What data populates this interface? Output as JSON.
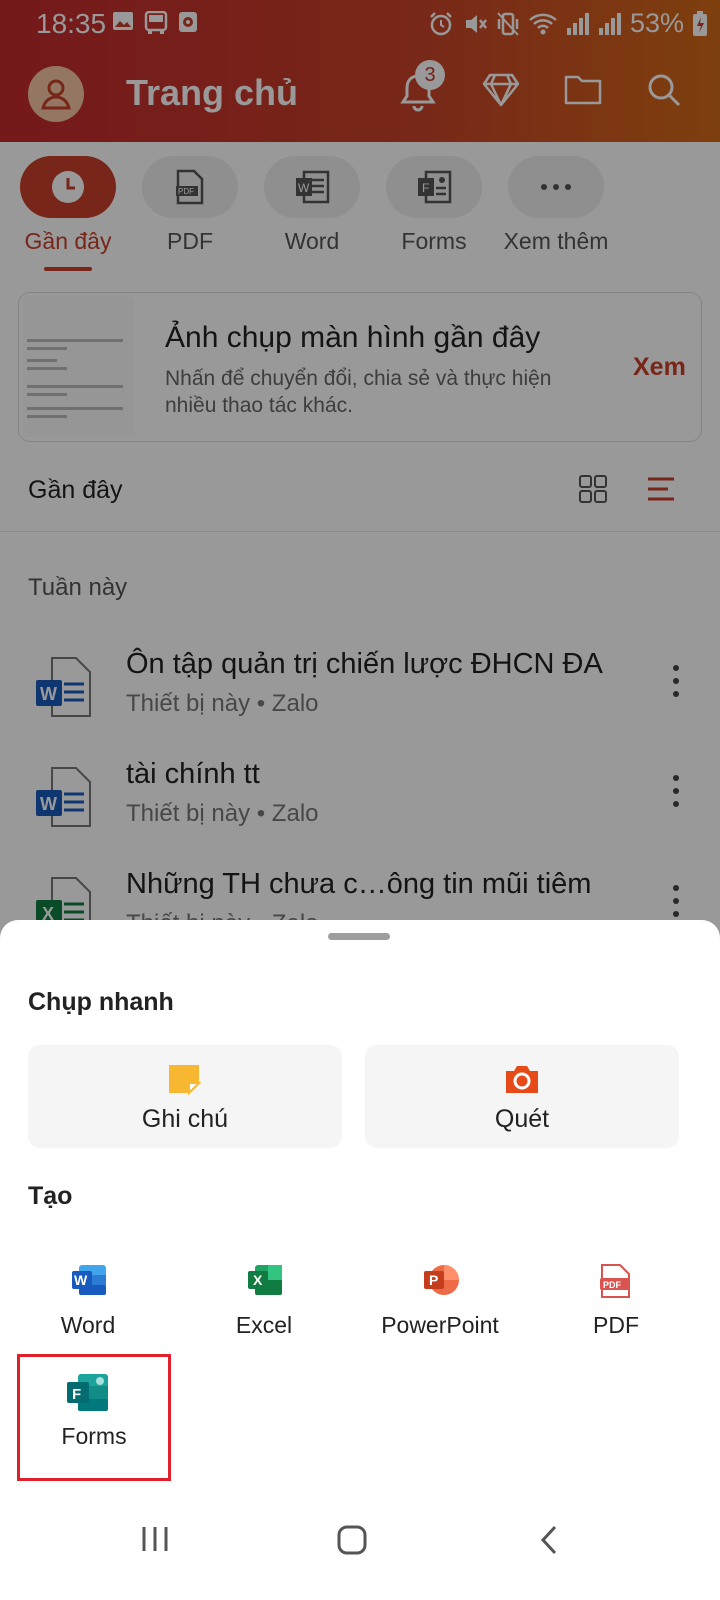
{
  "status_bar": {
    "time": "18:35",
    "battery": "53%"
  },
  "app_bar": {
    "title": "Trang chủ",
    "notification_count": "3"
  },
  "categories": [
    {
      "label": "Gần đây",
      "icon": "clock-icon",
      "active": true
    },
    {
      "label": "PDF",
      "icon": "pdf-icon",
      "active": false
    },
    {
      "label": "Word",
      "icon": "word-icon",
      "active": false
    },
    {
      "label": "Forms",
      "icon": "forms-icon",
      "active": false
    },
    {
      "label": "Xem thêm",
      "icon": "more-horizontal-icon",
      "active": false
    }
  ],
  "banner": {
    "title": "Ảnh chụp màn hình gần đây",
    "subtitle": "Nhấn để chuyển đổi, chia sẻ và thực hiện nhiều thao tác khác.",
    "action": "Xem"
  },
  "recent": {
    "title": "Gần đây",
    "week_label": "Tuần này",
    "files": [
      {
        "name": "Ôn tập quản trị chiến lược ĐHCN ĐA",
        "meta": "Thiết bị này • Zalo",
        "type": "word"
      },
      {
        "name": "tài chính tt",
        "meta": "Thiết bị này • Zalo",
        "type": "word"
      },
      {
        "name": "Những TH chưa c…ông tin mũi tiêm",
        "meta": "Thiết bị này • Zalo",
        "type": "excel"
      }
    ]
  },
  "sheet": {
    "quick_title": "Chụp nhanh",
    "quick_actions": [
      {
        "label": "Ghi chú",
        "icon": "sticky-note-icon"
      },
      {
        "label": "Quét",
        "icon": "camera-icon"
      }
    ],
    "create_title": "Tạo",
    "create_items": [
      {
        "label": "Word",
        "icon": "word-app-icon"
      },
      {
        "label": "Excel",
        "icon": "excel-app-icon"
      },
      {
        "label": "PowerPoint",
        "icon": "powerpoint-app-icon"
      },
      {
        "label": "PDF",
        "icon": "pdf-app-icon"
      },
      {
        "label": "Forms",
        "icon": "forms-app-icon",
        "highlighted": true
      }
    ]
  },
  "colors": {
    "brand": "#c8402a",
    "highlight": "#e0202a",
    "word": "#185abd",
    "excel": "#107c41",
    "powerpoint": "#c43e1c",
    "forms": "#03787c"
  }
}
